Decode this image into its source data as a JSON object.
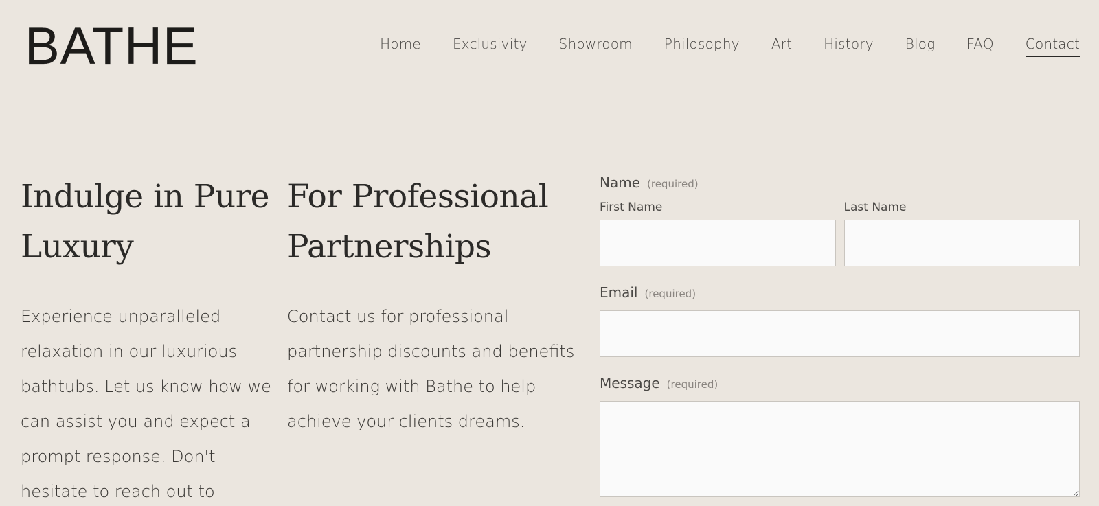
{
  "header": {
    "logo": "BATHE",
    "nav": [
      {
        "label": "Home",
        "active": false
      },
      {
        "label": "Exclusivity",
        "active": false
      },
      {
        "label": "Showroom",
        "active": false
      },
      {
        "label": "Philosophy",
        "active": false
      },
      {
        "label": "Art",
        "active": false
      },
      {
        "label": "History",
        "active": false
      },
      {
        "label": "Blog",
        "active": false
      },
      {
        "label": "FAQ",
        "active": false
      },
      {
        "label": "Contact",
        "active": true
      }
    ]
  },
  "left": {
    "heading": "Indulge in Pure Luxury",
    "body": "Experience unparalleled relaxation in our luxurious bathtubs. Let us know how we can assist you and expect a prompt response. Don't hesitate to reach out to"
  },
  "middle": {
    "heading": "For Professional Partnerships",
    "body": "Contact us for professional partnership discounts and benefits for working with Bathe to help achieve your clients dreams."
  },
  "form": {
    "name_label": "Name",
    "required_text": "(required)",
    "first_name_label": "First Name",
    "last_name_label": "Last Name",
    "email_label": "Email",
    "message_label": "Message"
  }
}
